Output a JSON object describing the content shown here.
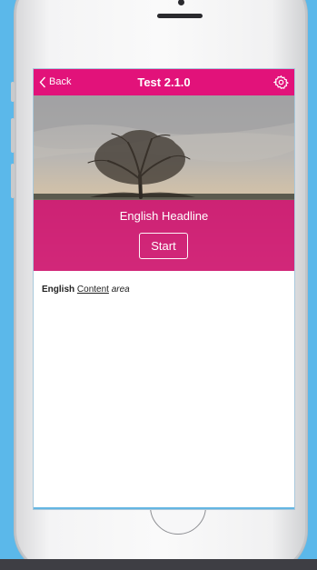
{
  "nav": {
    "back_label": "Back",
    "title": "Test 2.1.0"
  },
  "hero": {
    "headline": "English Headline",
    "start_label": "Start"
  },
  "content": {
    "bold": "English",
    "link": "Content",
    "italic": "area"
  },
  "icons": {
    "back": "chevron-left-icon",
    "settings": "gear-icon"
  },
  "colors": {
    "accent": "#e2127a",
    "background": "#5bb8ea"
  }
}
